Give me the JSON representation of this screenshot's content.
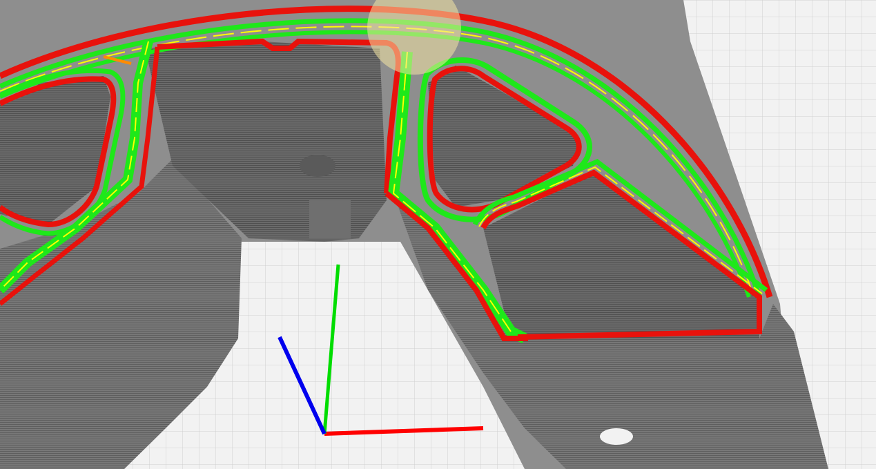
{
  "viewport": {
    "kind": "3D slicer G-code layer preview",
    "background_color": "#8e8e8e",
    "bed_color": "#f2f2f2",
    "bed_grid_color": "#d0d0d0",
    "model_color": "#777777",
    "model_shade_color": "#5e5e5e",
    "outer_wall_color": "#e8120c",
    "inner_wall_color": "#1ee81a",
    "infill_color": "#ffff00",
    "travel_color": "#ff8c00"
  },
  "axes": {
    "x_color": "#ff0000",
    "y_color": "#00dd00",
    "z_color": "#0000ee"
  },
  "gizmo": {
    "color": "#f4e6a4",
    "opacity": 0.55
  }
}
